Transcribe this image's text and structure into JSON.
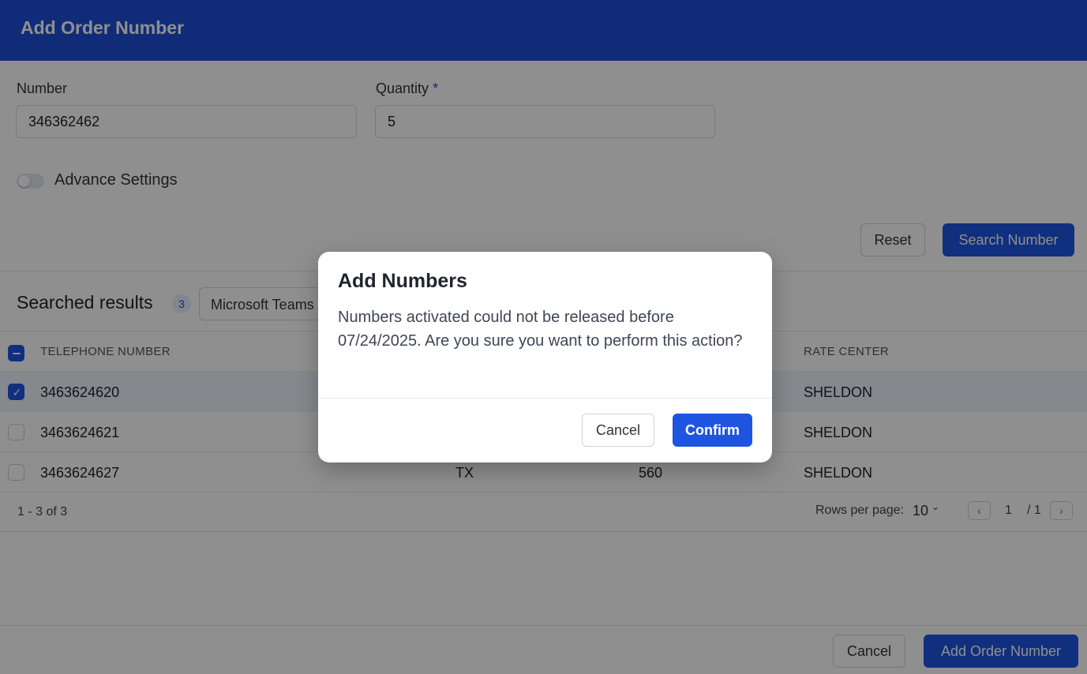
{
  "header": {
    "title": "Add Order Number"
  },
  "form": {
    "number_label": "Number",
    "number_value": "346362462",
    "quantity_label": "Quantity",
    "required_mark": "*",
    "quantity_value": "5",
    "advance_settings_label": "Advance Settings",
    "advance_settings_on": false,
    "reset_label": "Reset",
    "search_label": "Search Number"
  },
  "results": {
    "title": "Searched results",
    "count": "3",
    "filter_value": "Microsoft Teams"
  },
  "table": {
    "columns": [
      "TELEPHONE NUMBER",
      "RATE CENTER"
    ],
    "rows": [
      {
        "number": "3463624620",
        "state": "",
        "npa": "",
        "rate_center": "SHELDON",
        "checked": true
      },
      {
        "number": "3463624621",
        "state": "",
        "npa": "",
        "rate_center": "SHELDON",
        "checked": false
      },
      {
        "number": "3463624627",
        "state": "TX",
        "npa": "560",
        "rate_center": "SHELDON",
        "checked": false
      }
    ]
  },
  "pagination": {
    "range": "1 - 3 of 3",
    "rows_per_page_label": "Rows per page:",
    "rows_per_page_value": "10",
    "current_page": "1",
    "total_pages": "/ 1"
  },
  "footer": {
    "cancel_label": "Cancel",
    "submit_label": "Add Order Number"
  },
  "modal": {
    "title": "Add Numbers",
    "message": "Numbers activated could not be released before 07/24/2025. Are you sure you want to perform this action?",
    "cancel_label": "Cancel",
    "confirm_label": "Confirm"
  },
  "colors": {
    "header": "#1e4fd8",
    "primary": "#1e55e0",
    "overlay": "rgba(0,0,0,0.44)"
  },
  "icons": {
    "checkbox_check": "check-icon",
    "checkbox_indeterminate": "minus-icon",
    "prev": "chevron-left-icon",
    "next": "chevron-right-icon",
    "dropdown": "chevron-down-icon"
  }
}
